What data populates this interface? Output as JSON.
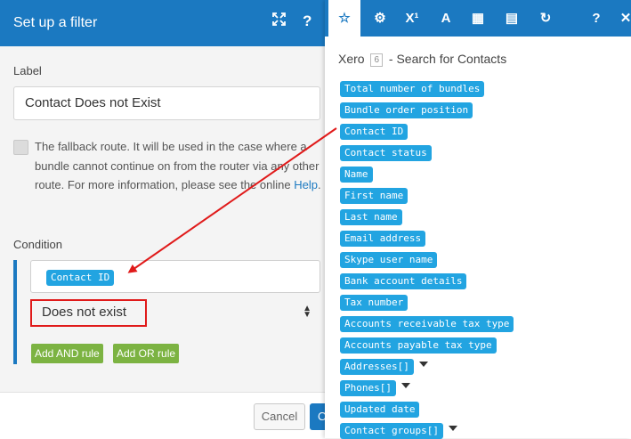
{
  "dialog": {
    "title": "Set up a filter",
    "expand_icon": "expand-icon",
    "help_label": "?",
    "label_caption": "Label",
    "label_value": "Contact Does not Exist",
    "fallback_text_1": "The fallback route. It will be used in the case where a bundle cannot continue on from the router via any other route. For more information, please see the online ",
    "fallback_link": "Help",
    "fallback_text_2": ".",
    "condition_caption": "Condition",
    "condition_token": "Contact ID",
    "operator_value": "Does not exist",
    "add_and_rule": "Add AND rule",
    "add_or_rule": "Add OR rule",
    "cancel_label": "Cancel",
    "ok_label": "O"
  },
  "panel": {
    "tabs": [
      {
        "icon": "star-icon",
        "glyph": "☆"
      },
      {
        "icon": "gear-icon",
        "glyph": "⚙"
      },
      {
        "icon": "superscript-icon",
        "glyph": "X¹"
      },
      {
        "icon": "text-icon",
        "glyph": "A"
      },
      {
        "icon": "calendar-icon",
        "glyph": "▦"
      },
      {
        "icon": "table-icon",
        "glyph": "▤"
      },
      {
        "icon": "rotate-icon",
        "glyph": "↻"
      },
      {
        "icon": "help-icon",
        "glyph": "?"
      },
      {
        "icon": "close-icon",
        "glyph": "✕"
      }
    ],
    "module_name": "Xero",
    "module_number": "6",
    "module_action": "- Search for Contacts",
    "items": [
      {
        "label": "Total number of bundles",
        "expandable": false
      },
      {
        "label": "Bundle order position",
        "expandable": false
      },
      {
        "label": "Contact ID",
        "expandable": false
      },
      {
        "label": "Contact status",
        "expandable": false
      },
      {
        "label": "Name",
        "expandable": false
      },
      {
        "label": "First name",
        "expandable": false
      },
      {
        "label": "Last name",
        "expandable": false
      },
      {
        "label": "Email address",
        "expandable": false
      },
      {
        "label": "Skype user name",
        "expandable": false
      },
      {
        "label": "Bank account details",
        "expandable": false
      },
      {
        "label": "Tax number",
        "expandable": false
      },
      {
        "label": "Accounts receivable tax type",
        "expandable": false
      },
      {
        "label": "Accounts payable tax type",
        "expandable": false
      },
      {
        "label": "Addresses[]",
        "expandable": true
      },
      {
        "label": "Phones[]",
        "expandable": true
      },
      {
        "label": "Updated date",
        "expandable": false
      },
      {
        "label": "Contact groups[]",
        "expandable": true
      }
    ]
  },
  "colors": {
    "header_blue": "#1b79c1",
    "token_blue": "#22a4e1",
    "button_green": "#7cb342",
    "annotation_red": "#e01a1a"
  }
}
